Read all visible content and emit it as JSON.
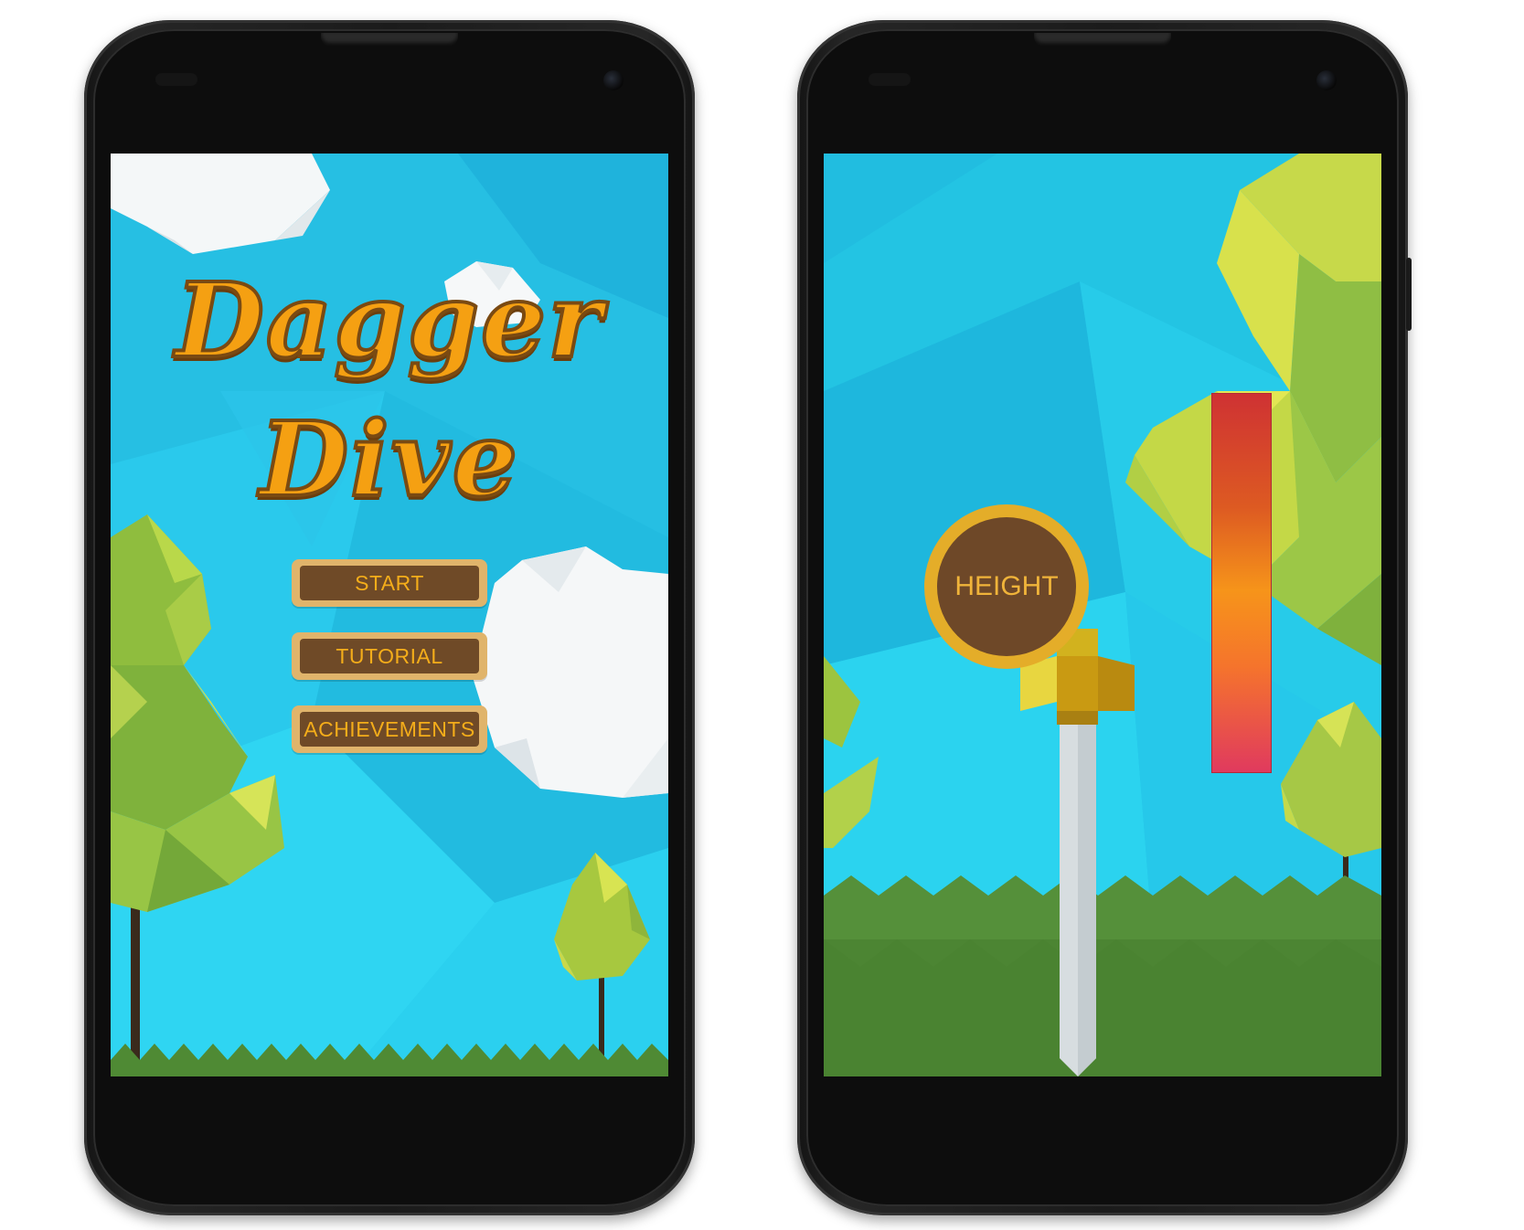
{
  "game": {
    "title_line1": "Dagger",
    "title_line2": "Dive"
  },
  "menu": {
    "start_label": "START",
    "tutorial_label": "TUTORIAL",
    "achievements_label": "ACHIEVEMENTS"
  },
  "hud": {
    "height_label": "HEIGHT",
    "power_meter_level": 1.0
  },
  "colors": {
    "sky": "#27c6e6",
    "title_fill": "#f5a012",
    "title_outline": "#7a4a12",
    "button_border": "#e0b46b",
    "button_fill": "#6f4a27",
    "button_text": "#f4ad1a",
    "grass": "#4f8a34",
    "phone_body": "#1b1b1b"
  },
  "icons": [
    "tree-icon",
    "cloud-icon",
    "sword-icon",
    "grass-spikes-icon"
  ]
}
